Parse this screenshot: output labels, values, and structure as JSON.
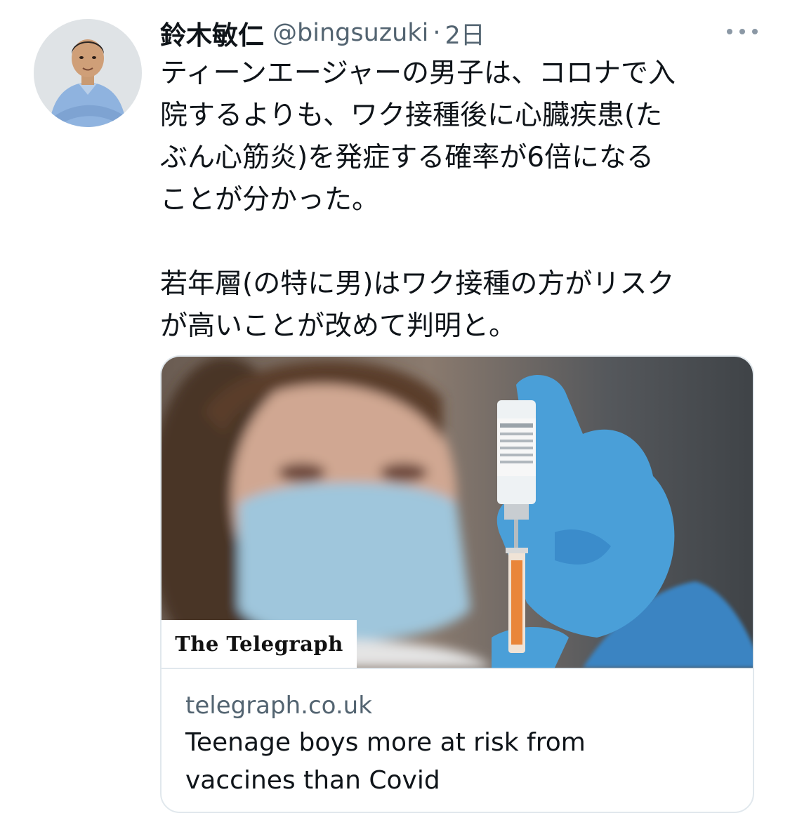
{
  "author": {
    "display_name": "鈴木敏仁",
    "handle": "@bingsuzuki",
    "separator": "·",
    "time": "2日"
  },
  "tweet": {
    "lines": [
      "ティーンエージャーの男子は、コロナで入",
      "院するよりも、ワク接種後に心臓疾患(た",
      "ぶん心筋炎)を発症する確率が6倍になる",
      "ことが分かった。",
      "",
      "若年層(の特に男)はワク接種の方がリスク",
      "が高いことが改めて判明と。"
    ]
  },
  "card": {
    "publisher": "The Telegraph",
    "domain": "telegraph.co.uk",
    "title": "Teenage boys more at risk from vaccines than Covid"
  },
  "icons": {
    "more": "more-horizontal-icon"
  },
  "colors": {
    "text_primary": "#0f1419",
    "text_secondary": "#536471",
    "border": "#e1e8ed",
    "glove_blue": "#4a9fd8"
  }
}
